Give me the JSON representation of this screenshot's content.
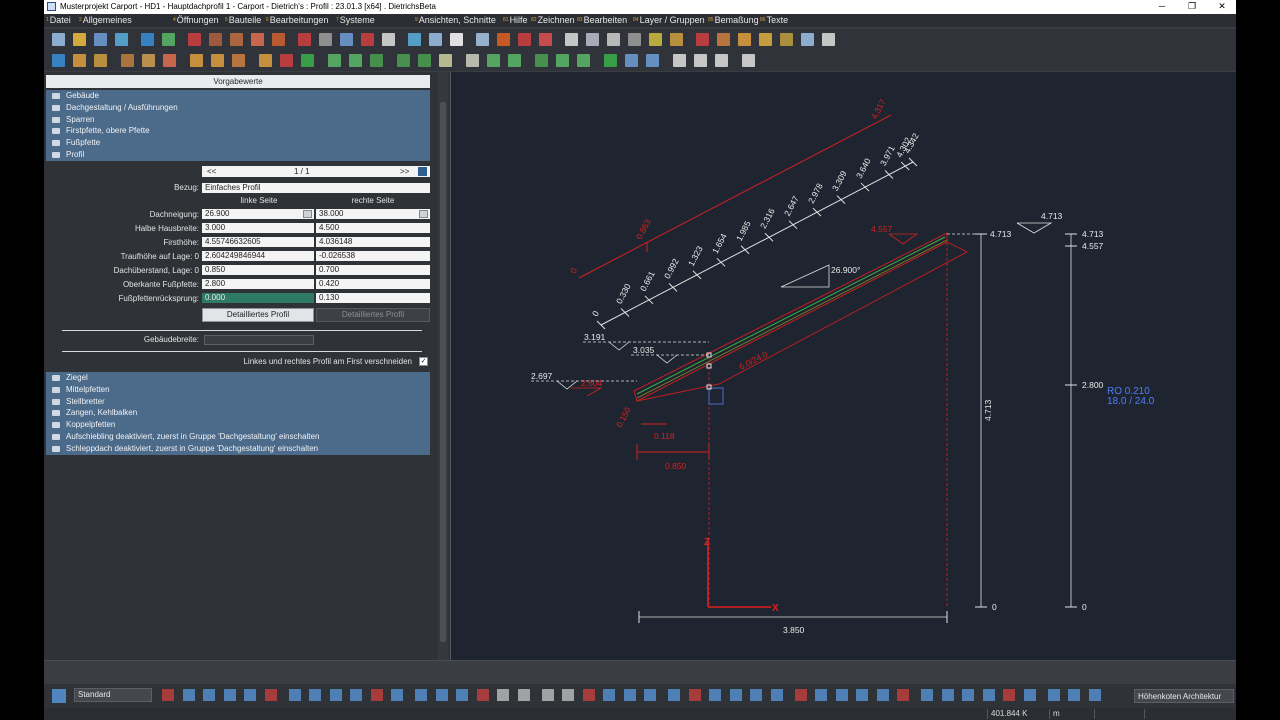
{
  "window": {
    "title": "Musterprojekt Carport - HD1 - Hauptdachprofil 1 - Carport - Dietrich's : Profil : 23.01.3 [x64] .      DietrichsBeta",
    "minimize": "─",
    "maximize": "❐",
    "close": "✕"
  },
  "menu": [
    {
      "num": "1",
      "label": "Datei"
    },
    {
      "num": "2",
      "label": "Allgemeines"
    },
    {
      "num": "4",
      "label": "Öffnungen"
    },
    {
      "num": "5",
      "label": "Bauteile"
    },
    {
      "num": "6",
      "label": "Bearbeitungen"
    },
    {
      "num": "7",
      "label": "Systeme"
    },
    {
      "num": "9",
      "label": "Ansichten, Schnitte"
    },
    {
      "num": "81",
      "label": "Hilfe"
    },
    {
      "num": "82",
      "label": "Zeichnen"
    },
    {
      "num": "83",
      "label": "Bearbeiten"
    },
    {
      "num": "84",
      "label": "Layer / Gruppen"
    },
    {
      "num": "85",
      "label": "Bemaßung"
    },
    {
      "num": "86",
      "label": "Texte"
    }
  ],
  "panel": {
    "title": "Vorgabewerte",
    "groups_top": [
      "Gebäude",
      "Dachgestaltung / Ausführungen",
      "Sparren",
      "Firstpfette, obere Pfette",
      "Fußpfette",
      "Profil"
    ],
    "nav": {
      "prev": "<<",
      "page": "1  /  1",
      "next": ">>"
    },
    "bezug_label": "Bezug:",
    "bezug_value": "Einfaches Profil",
    "col_left": "linke Seite",
    "col_right": "rechte Seite",
    "rows": [
      {
        "label": "Dachneigung:",
        "left": "26.900",
        "right": "38.000"
      },
      {
        "label": "Halbe Hausbreite:",
        "left": "3.000",
        "right": "4.500"
      },
      {
        "label": "Firsthöhe:",
        "left": "4.55746632605",
        "right": "4.036148"
      },
      {
        "label": "Traufhöhe auf Lage: 0",
        "left": "2.604249846944",
        "right": "-0.026538"
      },
      {
        "label": "Dachüberstand, Lage: 0",
        "left": "0.850",
        "right": "0.700"
      },
      {
        "label": "Oberkante Fußpfette:",
        "left": "2.800",
        "right": "0.420"
      },
      {
        "label": "Fußpfettenrücksprung:",
        "left": "0.000",
        "right": "0.130"
      }
    ],
    "btn_left": "Detailliertes Profil",
    "btn_right": "Detailliertes Profil",
    "gebaeudebreite_label": "Gebäudebreite:",
    "gebaeudebreite_value": "",
    "checkbox_label": "Linkes und rechtes Profil am First verschneiden",
    "checkbox_mark": "✓",
    "groups_bottom": [
      "Ziegel",
      "Mittelpfetten",
      "Stellbretter",
      "Zangen, Kehlbalken",
      "Koppelpfetten",
      "Aufschiebling deaktiviert, zuerst in Gruppe 'Dachgestaltung' einschalten",
      "Schleppdach deaktiviert, zuerst in Gruppe 'Dachgestaltung' einschalten"
    ]
  },
  "drawing": {
    "slope_ticks": [
      "0",
      "0.330",
      "0.661",
      "0.992",
      "1.323",
      "1.654",
      "1.985",
      "2.316",
      "2.647",
      "2.978",
      "3.309",
      "3.640",
      "3.971",
      "4.302",
      "4.342"
    ],
    "red_dims": {
      "zero": "0",
      "d0863": "0.863",
      "d4317": "4.317",
      "d4557": "4.557",
      "d2604": "2.604",
      "d0150": "0.150",
      "d0118": "0.118",
      "d0850": "0.850",
      "sparren": "6.0/24.0"
    },
    "white_labels": {
      "l3191": "3.191",
      "l3035": "3.035",
      "l2697": "2.697",
      "l4713top": "4.713",
      "l4713mid": "4.713",
      "angle": "26.900°",
      "bottom": "3.850"
    },
    "height_scale": {
      "h4713": "4.713",
      "h4557": "4.557",
      "h2800": "2.800",
      "h0": "0",
      "h0b": "0",
      "vert": "4.713"
    },
    "ro_line1": "RO 0.210",
    "ro_line2": "18.0 / 24.0",
    "axis_z": "Z",
    "axis_x": "X"
  },
  "bottom": {
    "style": "Standard",
    "layer": "Höhenkoten Architektur",
    "coord": "401.844 K",
    "unit": "m"
  }
}
